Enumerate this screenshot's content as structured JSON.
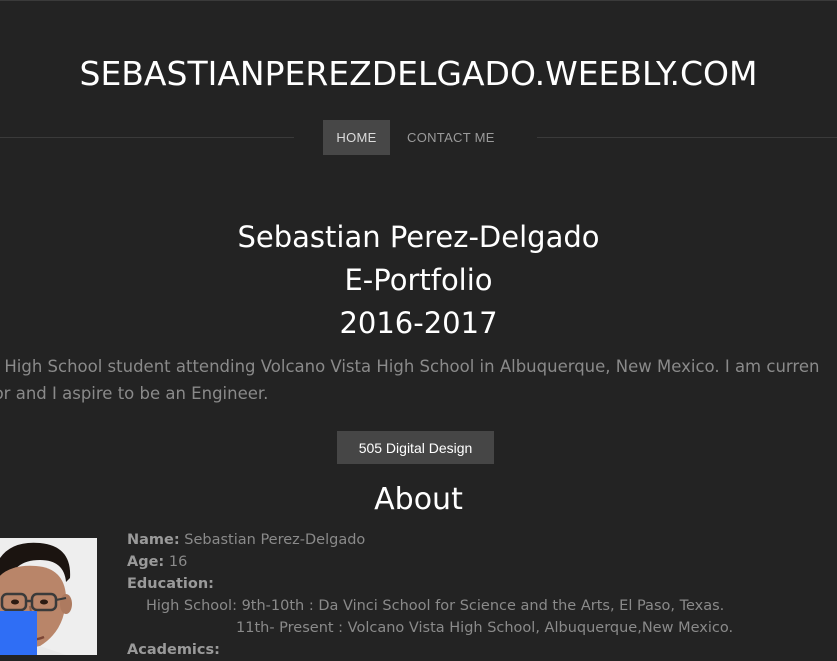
{
  "site": {
    "title": "SEBASTIANPEREZDELGADO.WEEBLY.COM"
  },
  "nav": {
    "items": [
      {
        "label": "HOME",
        "active": true
      },
      {
        "label": "CONTACT ME",
        "active": false
      }
    ]
  },
  "hero": {
    "line1": "Sebastian Perez-Delgado",
    "line2": "E-Portfolio",
    "line3": "2016-2017",
    "text_line1": "a High School student attending Volcano Vista High School in Albuquerque, New Mexico. I am curren",
    "text_line2": "ior and I aspire to be an Engineer."
  },
  "cta": {
    "label": "505 Digital Design"
  },
  "about": {
    "heading": "About",
    "name_label": "Name:",
    "name_value": " Sebastian Perez-Delgado",
    "age_label": "Age:",
    "age_value": " 16",
    "education_label": "Education:",
    "high_school_line": "High School: 9th-10th : Da Vinci School for Science and the Arts, El Paso, Texas.",
    "high_school_line2": "11th- Present : Volcano Vista High School, Albuquerque,New Mexico.",
    "academics_label": "Academics:"
  },
  "colors": {
    "background": "#232323",
    "nav_active_bg": "#474747",
    "button_bg": "#464646",
    "overlay_blue": "#2f6ef5"
  }
}
